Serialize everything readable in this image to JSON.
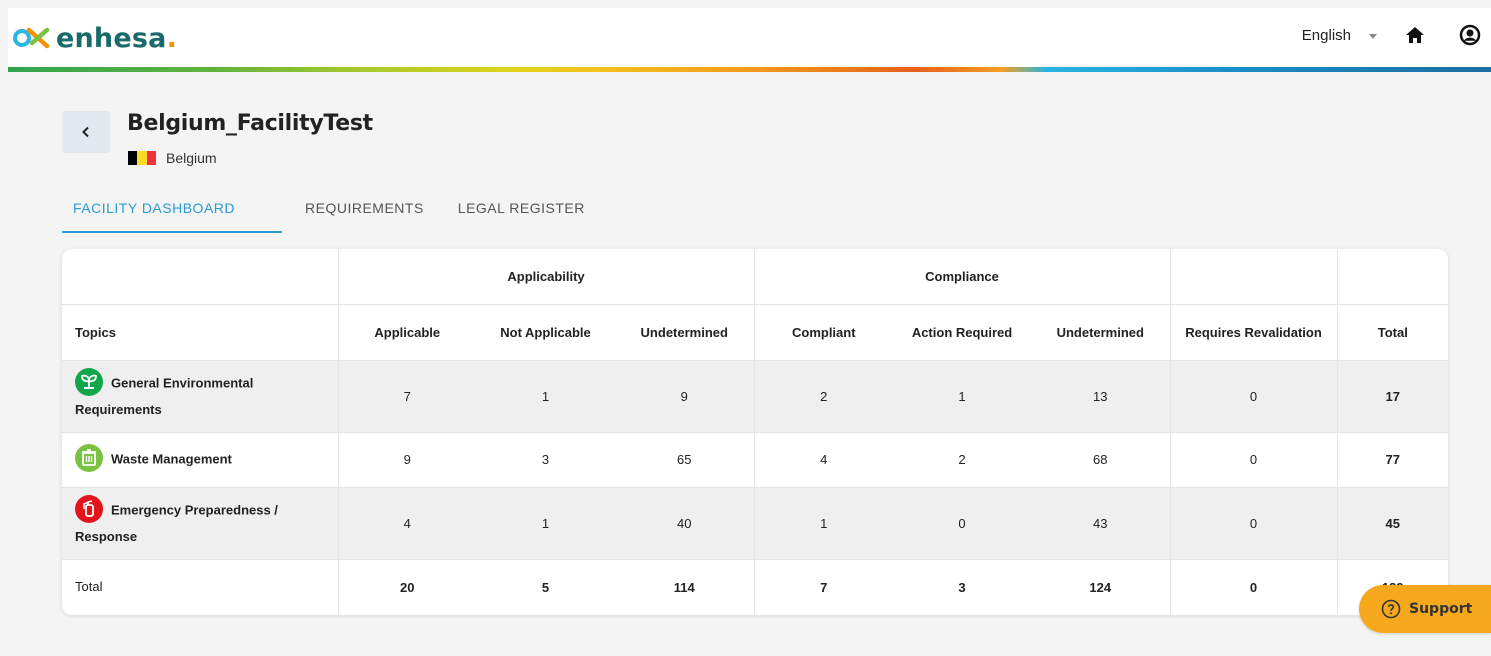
{
  "brand": {
    "logo_text": "enhesa",
    "logo_dot": "."
  },
  "header": {
    "language": "English"
  },
  "facility": {
    "name": "Belgium_FacilityTest",
    "country": "Belgium"
  },
  "tabs": [
    {
      "label": "FACILITY DASHBOARD",
      "active": true
    },
    {
      "label": "REQUIREMENTS",
      "active": false
    },
    {
      "label": "LEGAL REGISTER",
      "active": false
    }
  ],
  "table": {
    "groups": {
      "applicability": "Applicability",
      "compliance": "Compliance"
    },
    "columns": {
      "topics": "Topics",
      "applicable": "Applicable",
      "not_applicable": "Not Applicable",
      "undetermined_a": "Undetermined",
      "compliant": "Compliant",
      "action_required": "Action Required",
      "undetermined_c": "Undetermined",
      "requires_revalidation": "Requires Revalidation",
      "total": "Total"
    },
    "rows": [
      {
        "topic": "General Environmental Requirements",
        "icon": "plant-icon",
        "icon_color": "#12a64a",
        "applicable": "7",
        "not_applicable": "1",
        "undetermined_a": "9",
        "compliant": "2",
        "action_required": "1",
        "undetermined_c": "13",
        "requires_revalidation": "0",
        "total": "17"
      },
      {
        "topic": "Waste Management",
        "icon": "trash-bin-icon",
        "icon_color": "#7cc242",
        "applicable": "9",
        "not_applicable": "3",
        "undetermined_a": "65",
        "compliant": "4",
        "action_required": "2",
        "undetermined_c": "68",
        "requires_revalidation": "0",
        "total": "77"
      },
      {
        "topic": "Emergency Preparedness / Response",
        "icon": "fire-extinguisher-icon",
        "icon_color": "#e3151c",
        "applicable": "4",
        "not_applicable": "1",
        "undetermined_a": "40",
        "compliant": "1",
        "action_required": "0",
        "undetermined_c": "43",
        "requires_revalidation": "0",
        "total": "45"
      }
    ],
    "totals": {
      "label": "Total",
      "applicable": "20",
      "not_applicable": "5",
      "undetermined_a": "114",
      "compliant": "7",
      "action_required": "3",
      "undetermined_c": "124",
      "requires_revalidation": "0",
      "total": "139"
    }
  },
  "support": {
    "label": "Support"
  },
  "colors": {
    "accent": "#2b9bd3",
    "support": "#f5a81c",
    "brand_teal": "#1a6a6a",
    "brand_orange": "#f39200"
  }
}
